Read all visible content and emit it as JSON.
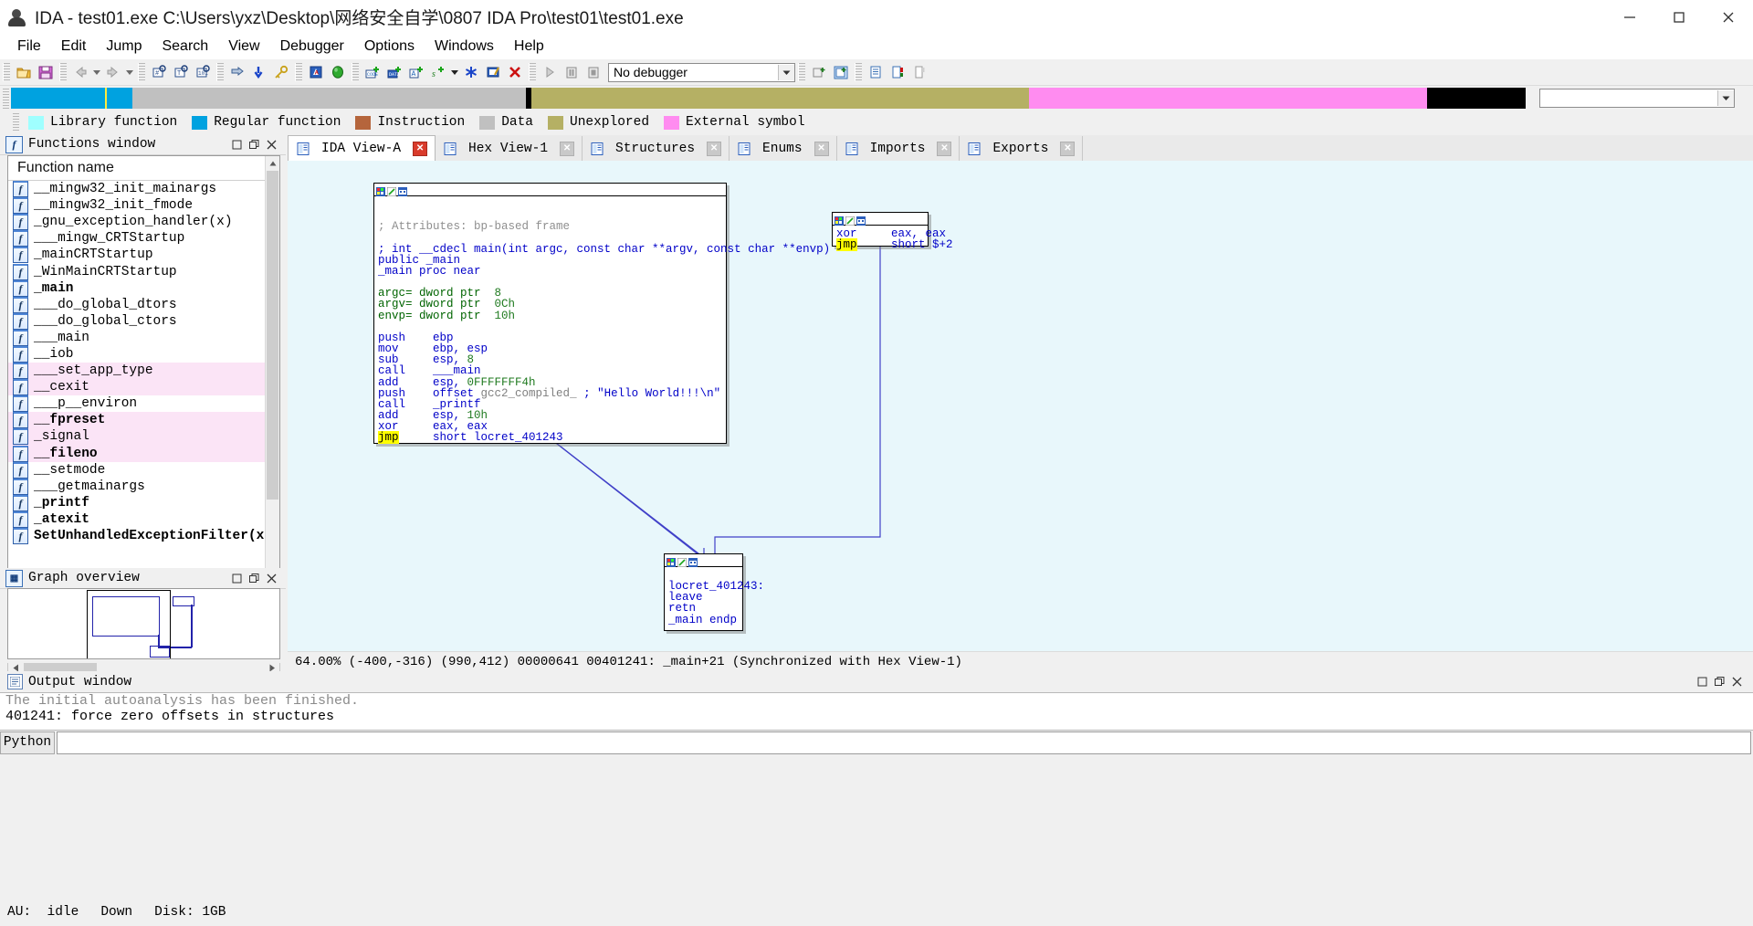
{
  "window": {
    "title": "IDA - test01.exe C:\\Users\\yxz\\Desktop\\网络安全自学\\0807 IDA Pro\\test01\\test01.exe",
    "minimize_label": "Minimize",
    "maximize_label": "Maximize",
    "close_label": "Close"
  },
  "menu": [
    {
      "label": "File"
    },
    {
      "label": "Edit"
    },
    {
      "label": "Jump"
    },
    {
      "label": "Search"
    },
    {
      "label": "View"
    },
    {
      "label": "Debugger"
    },
    {
      "label": "Options"
    },
    {
      "label": "Windows"
    },
    {
      "label": "Help"
    }
  ],
  "toolbar": {
    "debugger_select": "No debugger",
    "buttons": [
      "open-file",
      "save-file",
      "navigate-back",
      "navigate-back-dropdown",
      "navigate-forward",
      "navigate-forward-dropdown",
      "search-hex",
      "search-text",
      "search-binary",
      "jump-to-operand",
      "jump-down",
      "search-key",
      "warning-marker",
      "green-marker",
      "make-code",
      "make-data",
      "make-ascii",
      "make-struct",
      "make-struct-dropdown",
      "make-unexplored",
      "edit-function",
      "delete-item",
      "run",
      "pause",
      "stop"
    ]
  },
  "navigation_band": {
    "segments": [
      {
        "name": "library-function",
        "color": "#00a2e0",
        "width_pct": 5.2
      },
      {
        "name": "library-function-2",
        "color": "#00a2e0",
        "width_pct": 1.3
      },
      {
        "name": "library-function-3",
        "color": "#00a2e0",
        "width_pct": 1.5
      },
      {
        "name": "data",
        "color": "#c0c0c0",
        "width_pct": 26.0
      },
      {
        "name": "divider-black",
        "color": "#000000",
        "width_pct": 0.35
      },
      {
        "name": "unexplored",
        "color": "#b5b064",
        "width_pct": 32.8
      },
      {
        "name": "external-symbol",
        "color": "#ff8cf0",
        "width_pct": 26.3
      },
      {
        "name": "tail-black",
        "color": "#000000",
        "width_pct": 6.5
      }
    ]
  },
  "legend": [
    {
      "label": "Library function",
      "color": "#9fffff"
    },
    {
      "label": "Regular function",
      "color": "#00a2e0"
    },
    {
      "label": "Instruction",
      "color": "#b5653c"
    },
    {
      "label": "Data",
      "color": "#c0c0c0"
    },
    {
      "label": "Unexplored",
      "color": "#b5b064"
    },
    {
      "label": "External symbol",
      "color": "#ff8cf0"
    }
  ],
  "functions_window": {
    "title": "Functions window",
    "column_header": "Function name",
    "rows": [
      {
        "name": "__mingw32_init_mainargs",
        "highlight": false,
        "bold": false
      },
      {
        "name": "__mingw32_init_fmode",
        "highlight": false,
        "bold": false
      },
      {
        "name": "_gnu_exception_handler(x)",
        "highlight": false,
        "bold": false
      },
      {
        "name": "___mingw_CRTStartup",
        "highlight": false,
        "bold": false
      },
      {
        "name": "_mainCRTStartup",
        "highlight": false,
        "bold": false
      },
      {
        "name": "_WinMainCRTStartup",
        "highlight": false,
        "bold": false
      },
      {
        "name": "_main",
        "highlight": false,
        "bold": true
      },
      {
        "name": "___do_global_dtors",
        "highlight": false,
        "bold": false
      },
      {
        "name": "___do_global_ctors",
        "highlight": false,
        "bold": false
      },
      {
        "name": "___main",
        "highlight": false,
        "bold": false
      },
      {
        "name": "__iob",
        "highlight": false,
        "bold": false
      },
      {
        "name": "___set_app_type",
        "highlight": true,
        "bold": false
      },
      {
        "name": "__cexit",
        "highlight": true,
        "bold": false
      },
      {
        "name": "___p__environ",
        "highlight": false,
        "bold": false
      },
      {
        "name": "__fpreset",
        "highlight": true,
        "bold": true
      },
      {
        "name": "_signal",
        "highlight": true,
        "bold": false
      },
      {
        "name": "__fileno",
        "highlight": true,
        "bold": true
      },
      {
        "name": "__setmode",
        "highlight": false,
        "bold": false
      },
      {
        "name": "___getmainargs",
        "highlight": false,
        "bold": false
      },
      {
        "name": "_printf",
        "highlight": false,
        "bold": true
      },
      {
        "name": "_atexit",
        "highlight": false,
        "bold": true
      },
      {
        "name": "SetUnhandledExceptionFilter(x)",
        "highlight": false,
        "bold": true
      }
    ]
  },
  "graph_overview": {
    "title": "Graph overview"
  },
  "tabs": [
    {
      "label": "IDA View-A",
      "icon": "ida-view-icon",
      "active": true
    },
    {
      "label": "Hex View-1",
      "icon": "hex-view-icon",
      "active": false
    },
    {
      "label": "Structures",
      "icon": "structures-icon",
      "active": false
    },
    {
      "label": "Enums",
      "icon": "enums-icon",
      "active": false
    },
    {
      "label": "Imports",
      "icon": "imports-icon",
      "active": false
    },
    {
      "label": "Exports",
      "icon": "exports-icon",
      "active": false
    }
  ],
  "graph": {
    "nodes": [
      {
        "id": "main-block",
        "lines": [
          "",
          "",
          "; Attributes: bp-based frame",
          "",
          "; int __cdecl main(int argc, const char **argv, const char **envp)",
          "public _main",
          "_main proc near",
          "",
          "argc= dword ptr  8",
          "argv= dword ptr  0Ch",
          "envp= dword ptr  10h",
          "",
          "push    ebp",
          "mov     ebp, esp",
          "sub     esp, 8",
          "call    ___main",
          "add     esp, 0FFFFFFF4h",
          "push    offset gcc2_compiled_ ; \"Hello World!!!\\n\"",
          "call    _printf",
          "add     esp, 10h",
          "xor     eax, eax",
          "jmp     short locret_401243"
        ]
      },
      {
        "id": "xor-jmp-block",
        "lines": [
          "xor     eax, eax",
          "jmp     short $+2"
        ]
      },
      {
        "id": "locret-block",
        "lines": [
          "",
          "locret_401243:",
          "leave",
          "retn",
          "_main endp"
        ]
      }
    ]
  },
  "status_bar": {
    "text": "64.00% (-400,-316) (990,412) 00000641 00401241: _main+21 (Synchronized with Hex View-1)"
  },
  "output_window": {
    "title": "Output window",
    "lines": [
      "The initial autoanalysis has been finished.",
      "401241: force zero offsets in structures"
    ],
    "python_button": "Python",
    "input_value": ""
  },
  "bottom_bar": {
    "au": "AU:  idle",
    "state": "Down",
    "disk": "Disk: 1GB"
  }
}
